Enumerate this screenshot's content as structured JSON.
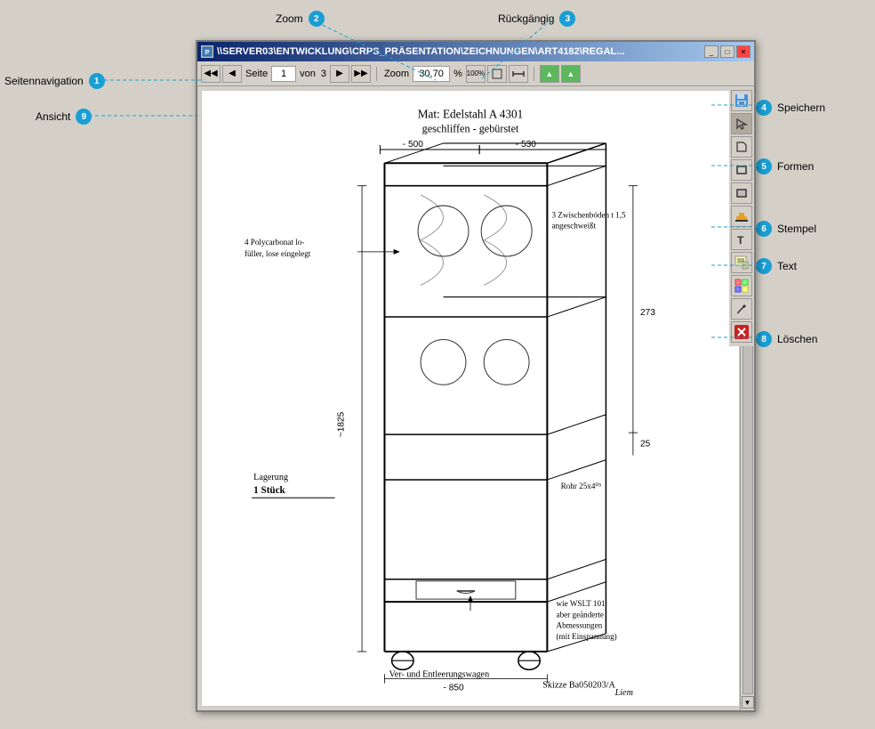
{
  "window": {
    "title": "\\\\SERVER03\\ENTWICKLUNG\\CRPS_PRÄSENTATION\\ZEICHNUNGEN\\ART4182\\REGAL...",
    "page_label": "Seite",
    "page_current": "1",
    "page_of": "von",
    "page_total": "3",
    "zoom_label": "Zoom",
    "zoom_value": "30.70",
    "zoom_percent": "%"
  },
  "labels": {
    "zoom": "Zoom",
    "rueckgangig": "Rückgängig",
    "seitennavigation": "Seitennavigation",
    "ansicht": "Ansicht",
    "speichern": "Speichern",
    "formen": "Formen",
    "stempel": "Stempel",
    "text": "Text",
    "loeschen": "Löschen"
  },
  "badges": {
    "zoom": "2",
    "rueckgangig": "3",
    "seitennavigation": "1",
    "ansicht": "9",
    "speichern": "4",
    "formen": "5",
    "stempel": "6",
    "text": "7",
    "loeschen": "8"
  },
  "toolbar": {
    "nav": {
      "first": "◀◀",
      "prev": "◀",
      "next": "▶",
      "last": "▶▶"
    },
    "zoom_buttons": {
      "hundred": "100%",
      "fit_page": "⊡",
      "fit_width": "↕"
    }
  }
}
